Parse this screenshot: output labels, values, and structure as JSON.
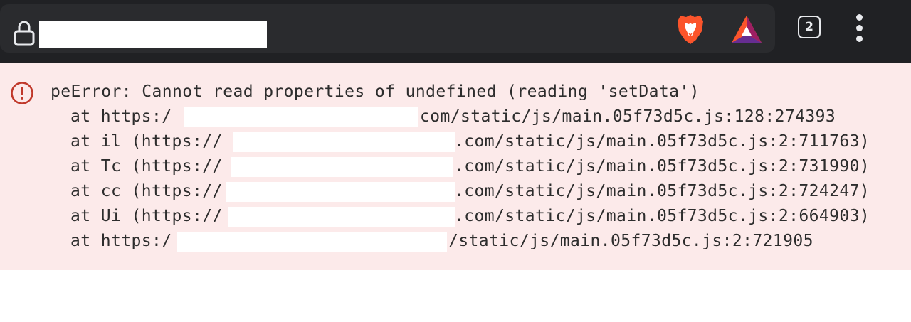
{
  "browser": {
    "tab_count": "2",
    "icons": {
      "lock": "lock-icon",
      "brave": "brave-lion-icon",
      "rewards": "bat-rewards-icon",
      "menu": "more-vertical-icon"
    },
    "colors": {
      "toolbar": "#202124",
      "url_bar": "#2a2b2e",
      "icon_fg": "#e8eaed"
    }
  },
  "error": {
    "icon": "error-circle-icon",
    "color": "#c0392b",
    "background": "#fceaea",
    "title": "peError: Cannot read properties of undefined (reading 'setData')",
    "stack": [
      {
        "prefix": "at https:/",
        "suffix": "com/static/js/main.05f73d5c.js:128:274393"
      },
      {
        "prefix": "at il (https://",
        "suffix": ".com/static/js/main.05f73d5c.js:2:711763)"
      },
      {
        "prefix": "at Tc (https://",
        "suffix": ".com/static/js/main.05f73d5c.js:2:731990)"
      },
      {
        "prefix": "at cc (https://",
        "suffix": ".com/static/js/main.05f73d5c.js:2:724247)"
      },
      {
        "prefix": "at Ui (https://",
        "suffix": ".com/static/js/main.05f73d5c.js:2:664903)"
      },
      {
        "prefix": "at https:/",
        "suffix": "/static/js/main.05f73d5c.js:2:721905"
      }
    ]
  }
}
